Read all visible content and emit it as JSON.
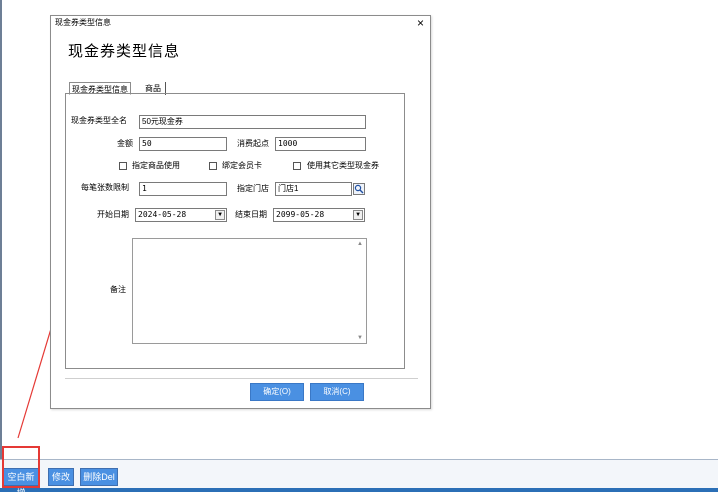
{
  "dialog": {
    "small_title": "现金券类型信息",
    "large_title": "现金券类型信息",
    "close_glyph": "×",
    "tabs": [
      {
        "label": "现金券类型信息"
      },
      {
        "label": "商品"
      }
    ],
    "fields": {
      "full_name_label": "现金券类型全名",
      "full_name_value": "50元现金券",
      "amount_label": "金额",
      "amount_value": "50",
      "min_spend_label": "消费起点",
      "min_spend_value": "1000",
      "limit_per_order_label": "每笔张数限制",
      "limit_per_order_value": "1",
      "store_label": "指定门店",
      "store_value": "门店1",
      "start_date_label": "开始日期",
      "start_date_value": "2024-05-28",
      "end_date_label": "结束日期",
      "end_date_value": "2099-05-28",
      "notes_label": "备注"
    },
    "checkboxes": [
      {
        "label": "指定商品使用"
      },
      {
        "label": "绑定会员卡"
      },
      {
        "label": "使用其它类型现金券"
      }
    ],
    "ok_button": "确定(O)",
    "cancel_button": "取消(C)"
  },
  "bottom_toolbar": {
    "buttons": [
      {
        "label": "空白新增"
      },
      {
        "label": "修改"
      },
      {
        "label": "删除Del"
      }
    ]
  },
  "colors": {
    "button_blue": "#4a90e2",
    "annotation_red": "#e53935"
  },
  "icons": {
    "search": "search-icon",
    "dropdown": "chevron-down-icon",
    "close": "close-icon"
  }
}
